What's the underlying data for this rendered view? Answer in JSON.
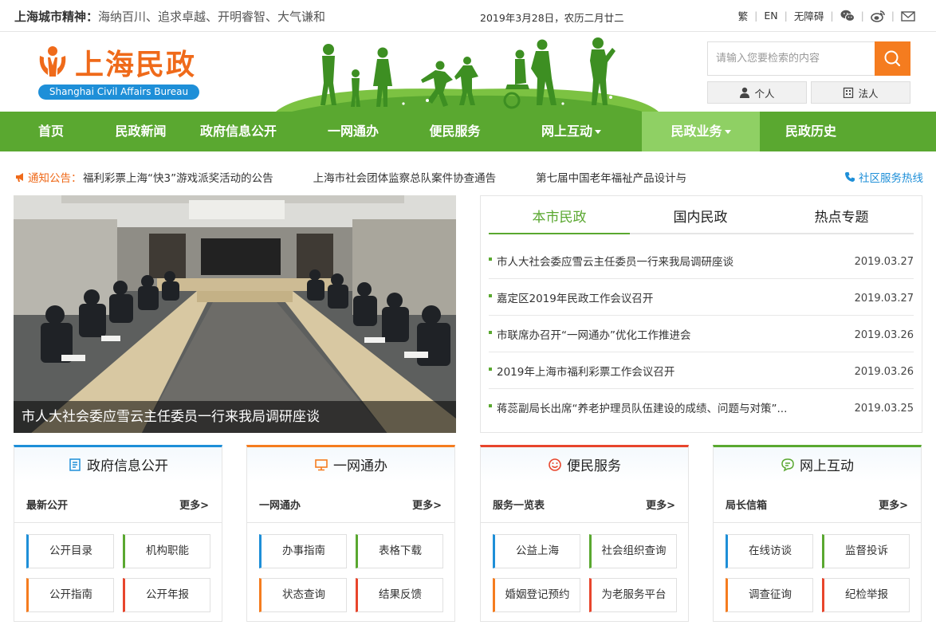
{
  "topbar": {
    "spirit_label": "上海城市精神：",
    "spirit_text": "海纳百川、追求卓越、开明睿智、大气谦和",
    "date": "2019年3月28日，农历二月廿二",
    "links": {
      "traditional": "繁",
      "english": "EN",
      "accessibility": "无障碍"
    }
  },
  "header": {
    "logo_text": "上海民政",
    "logo_sub": "Shanghai Civil Affairs Bureau",
    "search_placeholder": "请输入您要检索的内容",
    "personal": "个人",
    "corporate": "法人"
  },
  "nav": {
    "items": [
      {
        "label": "首页"
      },
      {
        "label": "民政新闻"
      },
      {
        "label": "政府信息公开"
      },
      {
        "label": "一网通办"
      },
      {
        "label": "便民服务"
      },
      {
        "label": "网上互动"
      },
      {
        "label": "民政业务"
      },
      {
        "label": "民政历史"
      }
    ]
  },
  "notice": {
    "label": "通知公告：",
    "items": [
      "福利彩票上海“快3”游戏派奖活动的公告",
      "上海市社会团体监察总队案件协查通告",
      "第七届中国老年福祉产品设计与"
    ],
    "hotline": "社区服务热线"
  },
  "photo": {
    "caption": "市人大社会委应雪云主任委员一行来我局调研座谈"
  },
  "news": {
    "tabs": [
      "本市民政",
      "国内民政",
      "热点专题"
    ],
    "rows": [
      {
        "title": "市人大社会委应雪云主任委员一行来我局调研座谈",
        "date": "2019.03.27"
      },
      {
        "title": "嘉定区2019年民政工作会议召开",
        "date": "2019.03.27"
      },
      {
        "title": "市联席办召开“一网通办”优化工作推进会",
        "date": "2019.03.26"
      },
      {
        "title": "2019年上海市福利彩票工作会议召开",
        "date": "2019.03.26"
      },
      {
        "title": "蒋蕊副局长出席“养老护理员队伍建设的成绩、问题与对策”...",
        "date": "2019.03.25"
      }
    ]
  },
  "cards": [
    {
      "title": "政府信息公开",
      "subtitle": "最新公开",
      "more": "更多>",
      "accent": "#1e8fd8",
      "buttons": [
        "公开目录",
        "机构职能",
        "公开指南",
        "公开年报"
      ]
    },
    {
      "title": "一网通办",
      "subtitle": "一网通办",
      "more": "更多>",
      "accent": "#f57c1f",
      "buttons": [
        "办事指南",
        "表格下载",
        "状态查询",
        "结果反馈"
      ]
    },
    {
      "title": "便民服务",
      "subtitle": "服务一览表",
      "more": "更多>",
      "accent": "#e8452c",
      "buttons": [
        "公益上海",
        "社会组织查询",
        "婚姻登记预约",
        "为老服务平台"
      ]
    },
    {
      "title": "网上互动",
      "subtitle": "局长信箱",
      "more": "更多>",
      "accent": "#5aa830",
      "buttons": [
        "在线访谈",
        "监督投诉",
        "调查征询",
        "纪检举报"
      ]
    }
  ]
}
